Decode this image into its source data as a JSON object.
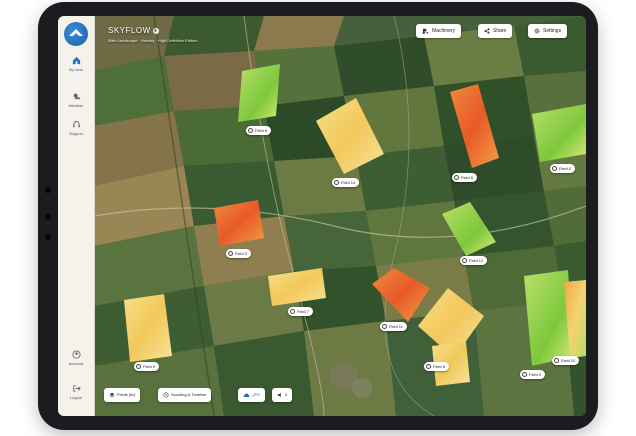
{
  "app": {
    "title": "SKYFLOW",
    "subtitle": "Main Landscape · Norway · High Definition Edition"
  },
  "sidebar": {
    "items": [
      {
        "label": "My farm",
        "icon": "home-icon",
        "active": true
      },
      {
        "label": "Weather",
        "icon": "weather-icon",
        "active": false
      },
      {
        "label": "Support",
        "icon": "headset-icon",
        "active": false
      }
    ],
    "bottom": [
      {
        "label": "Account",
        "icon": "account-icon"
      },
      {
        "label": "Logout",
        "icon": "logout-icon"
      }
    ]
  },
  "toolbar": {
    "machinery_label": "Machinery",
    "share_label": "Share",
    "settings_label": "Settings"
  },
  "fields": [
    {
      "label": "Field 8"
    },
    {
      "label": "Field 14"
    },
    {
      "label": "Field 5"
    },
    {
      "label": "Field 2"
    },
    {
      "label": "Field 12"
    },
    {
      "label": "Field 3"
    },
    {
      "label": "Field 7"
    },
    {
      "label": "Field 11"
    },
    {
      "label": "Field 6"
    },
    {
      "label": "Field 4"
    },
    {
      "label": "Field 9"
    },
    {
      "label": "Field 10"
    }
  ],
  "bottombar": {
    "fields_label": "Fields (fix)",
    "scouting_label": "Scouting & Timeline",
    "weather_label": "-2°C",
    "audio_label": "0"
  },
  "colors": {
    "accent": "#2a6cc7",
    "ndvi_low": "#e8562a",
    "ndvi_mid": "#f2c35a",
    "ndvi_high": "#7fcf3c"
  }
}
